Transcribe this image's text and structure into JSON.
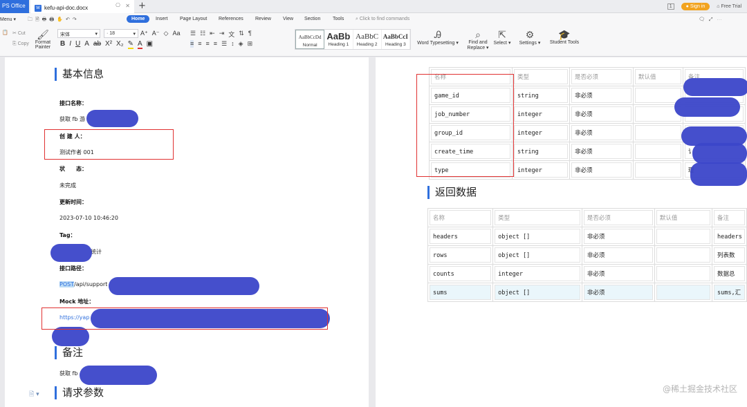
{
  "titlebar": {
    "app_tab": "PS Office",
    "doc_tab": "kefu-api-doc.docx",
    "doc_icon": "W",
    "new_tab": "+",
    "page_count": "1",
    "sign_in": "Sign in",
    "free_trial": "Free Trial"
  },
  "menu": {
    "menu_label": "Menu",
    "tabs": [
      "Home",
      "Insert",
      "Page Layout",
      "References",
      "Review",
      "View",
      "Section",
      "Tools"
    ],
    "find_commands": "Click to find commands"
  },
  "ribbon": {
    "cut": "Cut",
    "copy": "Copy",
    "format_painter": "Format Painter",
    "font_name": "宋体",
    "font_size": "18",
    "styles": [
      {
        "preview": "AaBbCcDd",
        "name": "Normal"
      },
      {
        "preview": "AaBb",
        "name": "Heading 1"
      },
      {
        "preview": "AaBbC",
        "name": "Heading 2"
      },
      {
        "preview": "AaBbCcI",
        "name": "Heading 3"
      }
    ],
    "word_typesetting": "Word Typesetting",
    "find_replace": "Find and Replace",
    "select": "Select",
    "settings": "Settings",
    "student_tools": "Student Tools"
  },
  "left_page": {
    "section_basic": "基本信息",
    "api_name_label": "接口名称：",
    "api_name_value": "获取 fb 游",
    "creator_label": "创 建 人：",
    "creator_value": "测试作者 001",
    "status_label": "状　　态：",
    "status_value": "未完成",
    "updated_label": "更新时间：",
    "updated_value": "2023-07-10 10:46:20",
    "tag_label": "Tag：",
    "tag_value": "统计",
    "path_label": "接口路径：",
    "path_method": "POST",
    "path_value": "/api/support",
    "mock_label": "Mock 地址：",
    "mock_value": "https://yap",
    "section_remark": "备注",
    "remark_value": "获取 fb",
    "section_params": "请求参数"
  },
  "right_page": {
    "params_table": {
      "headers": [
        "名称",
        "类型",
        "是否必须",
        "默认值",
        "备注"
      ],
      "rows": [
        [
          "game_id",
          "string",
          "非必须",
          "",
          ""
        ],
        [
          "job_number",
          "integer",
          "非必须",
          "",
          ""
        ],
        [
          "group_id",
          "integer",
          "非必须",
          "",
          ""
        ],
        [
          "create_time",
          "string",
          "非必须",
          "",
          "讠"
        ],
        [
          "type",
          "integer",
          "非必须",
          "",
          "理"
        ]
      ]
    },
    "section_return": "返回数据",
    "return_table": {
      "headers": [
        "名称",
        "类型",
        "是否必须",
        "默认值",
        "备注"
      ],
      "rows": [
        [
          "headers",
          "object  []",
          "非必须",
          "",
          "headers"
        ],
        [
          "rows",
          "object  []",
          "非必须",
          "",
          "列表数"
        ],
        [
          "counts",
          "integer",
          "非必须",
          "",
          "数据总"
        ],
        [
          "sums",
          "object  []",
          "非必须",
          "",
          "sums,汇"
        ]
      ]
    },
    "watermark": "@稀土掘金技术社区"
  }
}
